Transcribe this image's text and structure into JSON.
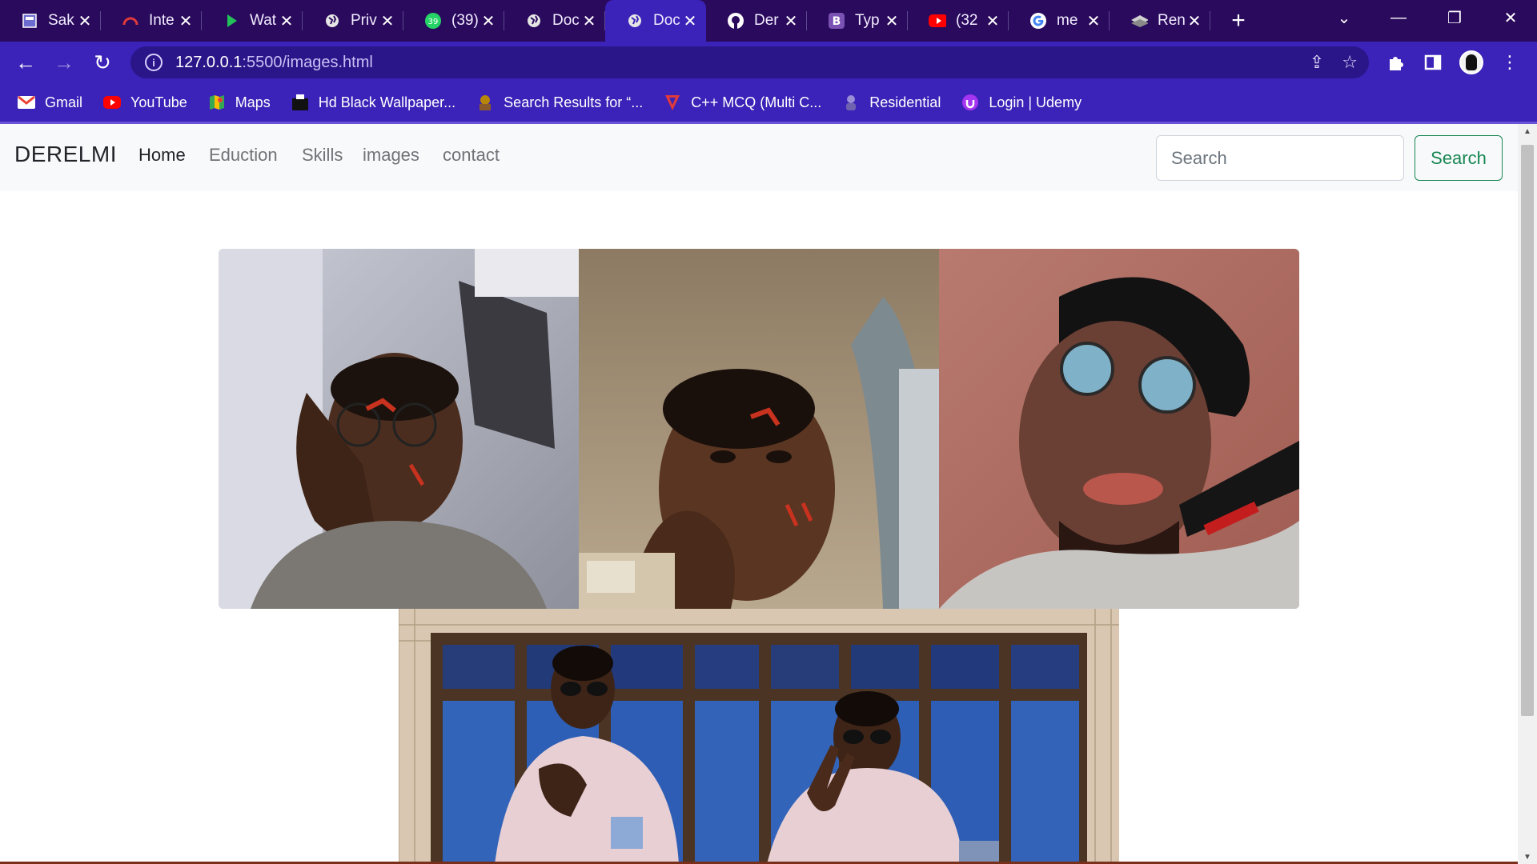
{
  "browser": {
    "tabs": [
      {
        "title": "Sak",
        "icon": "page-icon",
        "color": "#4b4ba8"
      },
      {
        "title": "Inte",
        "icon": "arc-icon",
        "color": "#e03a3a"
      },
      {
        "title": "Wat",
        "icon": "play-icon",
        "color": "#23c15a"
      },
      {
        "title": "Priv",
        "icon": "globe-icon",
        "color": "#e6e6e6"
      },
      {
        "title": "(39)",
        "icon": "chat-icon",
        "color": "#25d366"
      },
      {
        "title": "Doc",
        "icon": "globe-icon",
        "color": "#e6e6e6"
      },
      {
        "title": "Doc",
        "icon": "globe-icon",
        "color": "#e6e6e6",
        "active": true
      },
      {
        "title": "Der",
        "icon": "github-icon",
        "color": "#ffffff"
      },
      {
        "title": "Typ",
        "icon": "bootstrap-icon",
        "color": "#7952b3"
      },
      {
        "title": "(32",
        "icon": "youtube-icon",
        "color": "#ff0000"
      },
      {
        "title": "me",
        "icon": "google-icon",
        "color": "#4285f4"
      },
      {
        "title": "Ren",
        "icon": "layers-icon",
        "color": "#d0d0d0"
      }
    ],
    "url": {
      "host": "127.0.0.1",
      "path": ":5500/images.html"
    },
    "bookmarks": [
      {
        "label": "Gmail",
        "icon": "gmail-icon",
        "color": "#ea4335"
      },
      {
        "label": "YouTube",
        "icon": "youtube-icon",
        "color": "#ff0000"
      },
      {
        "label": "Maps",
        "icon": "maps-icon",
        "color": "#34a853"
      },
      {
        "label": "Hd Black Wallpaper...",
        "icon": "wallpaper-icon",
        "color": "#111111"
      },
      {
        "label": "Search Results for “...",
        "icon": "search-results-icon",
        "color": "#b8860b"
      },
      {
        "label": "C++ MCQ (Multi C...",
        "icon": "cpp-icon",
        "color": "#e03a3a"
      },
      {
        "label": "Residential",
        "icon": "residential-icon",
        "color": "#9a8ed6"
      },
      {
        "label": "Login | Udemy",
        "icon": "udemy-icon",
        "color": "#a435f0"
      }
    ]
  },
  "site": {
    "brand": "DERELMI",
    "nav": [
      {
        "label": "Home",
        "active": true
      },
      {
        "label": "Eduction"
      },
      {
        "label": "Skills"
      },
      {
        "label": "images"
      },
      {
        "label": "contact"
      }
    ],
    "search": {
      "placeholder": "Search",
      "button": "Search",
      "accent": "#198754"
    },
    "photos": [
      {
        "name": "photo-selfie-hand-on-cheek"
      },
      {
        "name": "photo-selfie-looking-up"
      },
      {
        "name": "photo-selfie-cap-glasses"
      },
      {
        "name": "photo-standing-sunglasses"
      },
      {
        "name": "photo-peace-sign-sunglasses"
      }
    ]
  }
}
